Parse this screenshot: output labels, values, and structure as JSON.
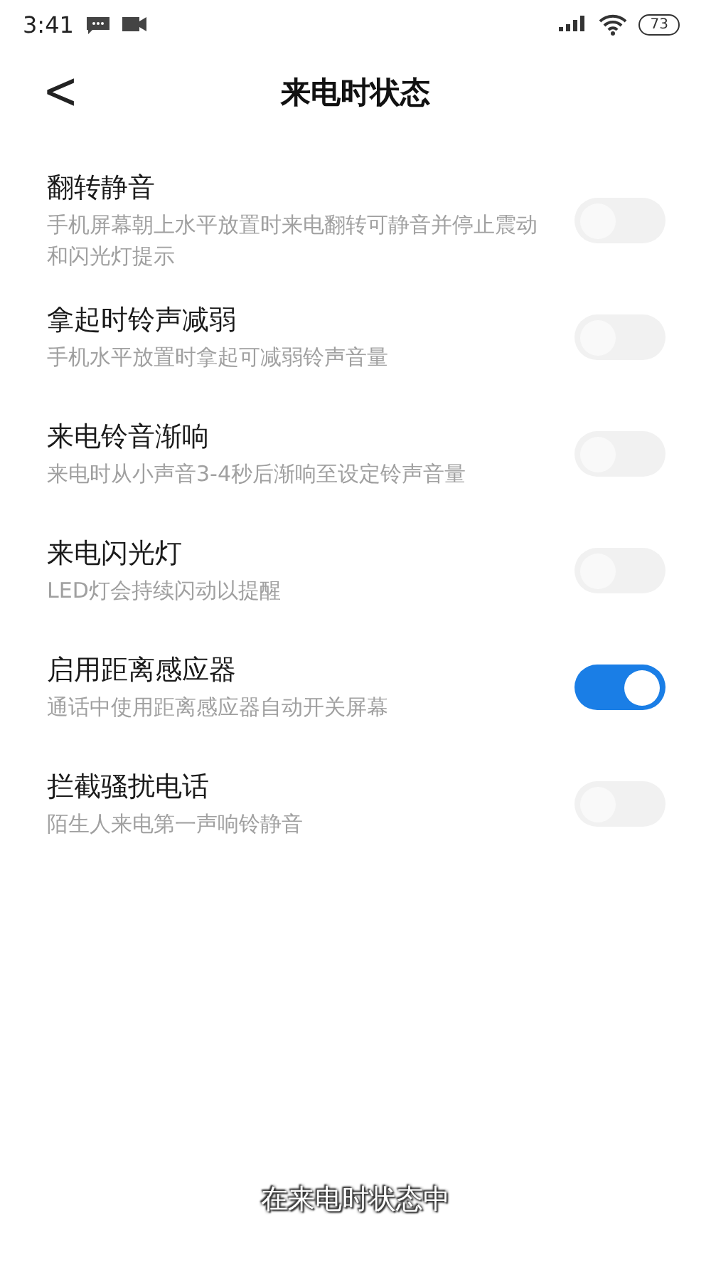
{
  "status_bar": {
    "time": "3:41",
    "battery": "73"
  },
  "header": {
    "back": "<",
    "title": "来电时状态"
  },
  "settings": [
    {
      "title": "翻转静音",
      "description": "手机屏幕朝上水平放置时来电翻转可静音并停止震动和闪光灯提示",
      "on": false
    },
    {
      "title": "拿起时铃声减弱",
      "description": "手机水平放置时拿起可减弱铃声音量",
      "on": false
    },
    {
      "title": "来电铃音渐响",
      "description": "来电时从小声音3-4秒后渐响至设定铃声音量",
      "on": false
    },
    {
      "title": "来电闪光灯",
      "description": "LED灯会持续闪动以提醒",
      "on": false
    },
    {
      "title": "启用距离感应器",
      "description": "通话中使用距离感应器自动开关屏幕",
      "on": true
    },
    {
      "title": "拦截骚扰电话",
      "description": "陌生人来电第一声响铃静音",
      "on": false
    }
  ],
  "caption": "在来电时状态中"
}
